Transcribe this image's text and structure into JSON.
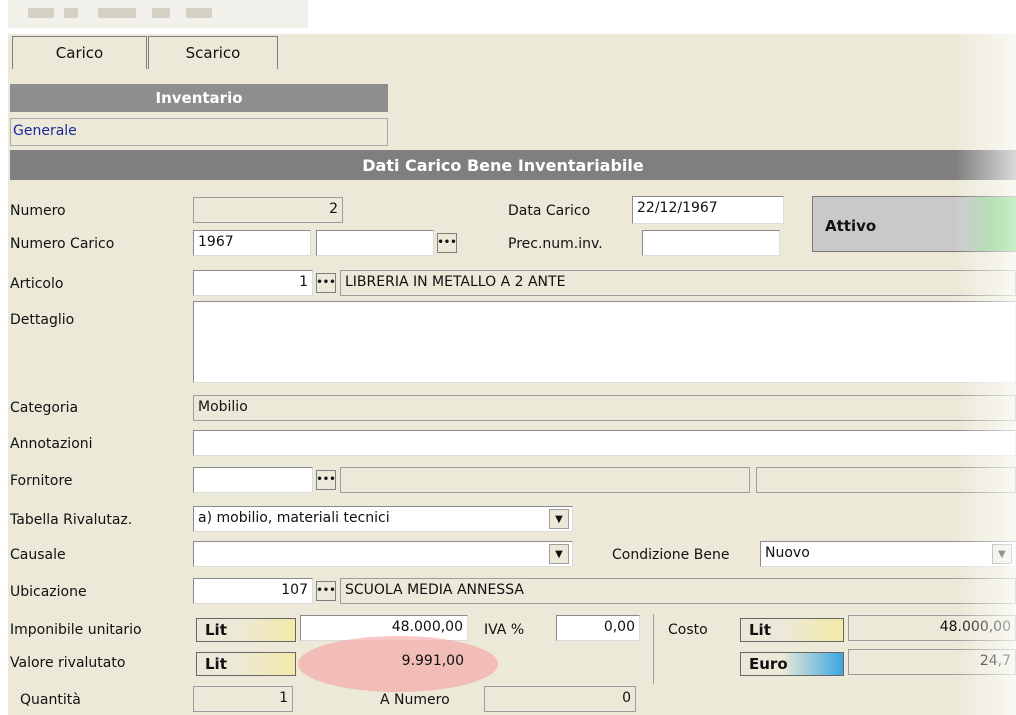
{
  "tabs": [
    "Carico",
    "Scarico"
  ],
  "section_inventario": "Inventario",
  "generale": "Generale",
  "section_dati": "Dati Carico Bene Inventariabile",
  "status": {
    "label": "Attivo"
  },
  "fields": {
    "numero_label": "Numero",
    "numero_value": "2",
    "data_carico_label": "Data Carico",
    "data_carico_value": "22/12/1967",
    "numero_carico_label": "Numero Carico",
    "numero_carico_value": "1967",
    "prec_num_inv_label": "Prec.num.inv.",
    "articolo_label": "Articolo",
    "articolo_code": "1",
    "articolo_desc": "LIBRERIA IN METALLO A 2 ANTE",
    "dettaglio_label": "Dettaglio",
    "categoria_label": "Categoria",
    "categoria_value": "Mobilio",
    "annotazioni_label": "Annotazioni",
    "fornitore_label": "Fornitore",
    "tabella_label": "Tabella Rivalutaz.",
    "tabella_value": "a) mobilio, materiali tecnici",
    "causale_label": "Causale",
    "condizione_label": "Condizione Bene",
    "condizione_value": "Nuovo",
    "ubicazione_label": "Ubicazione",
    "ubicazione_code": "107",
    "ubicazione_desc": "SCUOLA MEDIA ANNESSA",
    "imponibile_label": "Imponibile unitario",
    "imponibile_currency": "Lit",
    "imponibile_value": "48.000,00",
    "iva_label": "IVA %",
    "iva_value": "0,00",
    "costo_label": "Costo",
    "costo_currency": "Lit",
    "costo_value": "48.000,00",
    "valore_label": "Valore rivalutato",
    "valore_currency": "Lit",
    "valore_value": "9.991,00",
    "euro_label": "Euro",
    "euro_value": "24,7",
    "quantita_label": "Quantità",
    "quantita_value": "1",
    "a_numero_label": "A Numero",
    "a_numero_value": "0"
  },
  "colors": {
    "panel": "#ece9d8",
    "header": "#8e8e8e",
    "lit": "#f3e9a8",
    "euro": "#3aa6df",
    "status_green": "#3ccc3c",
    "highlight": "#f7b8b8"
  }
}
